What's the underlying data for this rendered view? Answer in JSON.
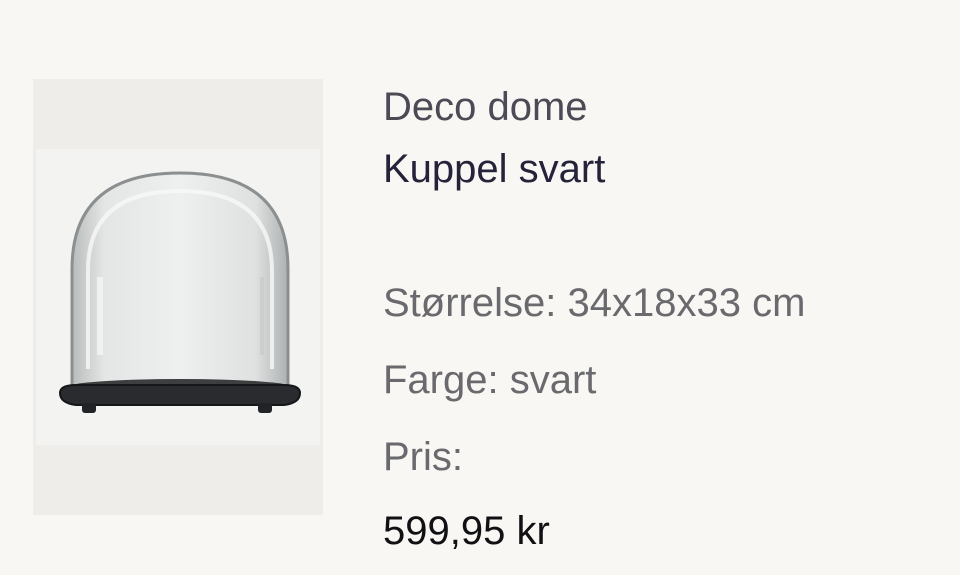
{
  "product": {
    "image_alt": "glass-dome-black-base",
    "brand": "Deco dome",
    "name": "Kuppel svart",
    "size_label": "Størrelse:",
    "size_value": "34x18x33 cm",
    "color_label": "Farge:",
    "color_value": "svart",
    "price_label": "Pris:",
    "price": "599,95 kr"
  },
  "colors": {
    "background": "#f8f7f3",
    "brand_text": "#4c4b55",
    "name_text": "#25223a",
    "spec_text": "#6a6a6e",
    "price_text": "#111114"
  }
}
